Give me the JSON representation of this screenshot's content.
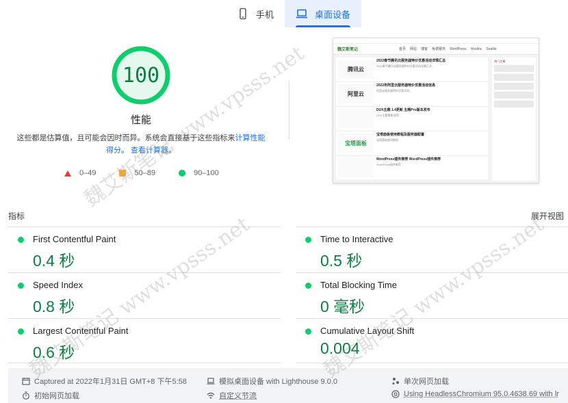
{
  "tabs": [
    {
      "label": "手机",
      "icon": "phone-icon",
      "active": false
    },
    {
      "label": "桌面设备",
      "icon": "laptop-icon",
      "active": true
    }
  ],
  "gauge": {
    "score": "100",
    "title": "性能",
    "color": "#0cce6b"
  },
  "description": {
    "text": "这些都是估算值，且可能会因时而异。系统会直接基于这些指标来",
    "link1": "计算性能得分",
    "mid": "。",
    "link2": "查看计算器",
    "end": "。"
  },
  "legend": [
    {
      "shape": "triangle",
      "color": "#ff3333",
      "label": "0–49"
    },
    {
      "shape": "square",
      "color": "#ffaa33",
      "label": "50–89"
    },
    {
      "shape": "circle",
      "color": "#0cce6b",
      "label": "90–100"
    }
  ],
  "thumbnail": {
    "logo": "魏艾斯笔记",
    "nav": [
      "首页",
      "网站",
      "博客",
      "免费服务",
      "WordPress",
      "Hostloc",
      "Seafile"
    ],
    "posts": [
      {
        "img": "腾讯云",
        "title": "2022春节腾讯云服务器特价优惠活动详情汇总",
        "text": "2022春节腾讯云服务器特价优惠活动详情汇总..."
      },
      {
        "img": "阿里云",
        "title": "2022年阿里云服务器特价优惠活动信息",
        "text": "阿里云服务器特价优惠活动..."
      },
      {
        "img": "",
        "title": "DUX主题 1.4更新 主题Pro版本发布",
        "text": "DUX主题更新说明..."
      },
      {
        "img": "宝塔面板",
        "title": "宝塔面板使用教程及服务器配置",
        "text": "宝塔面板使用教程..."
      },
      {
        "img": "",
        "title": "WordPress插件推荐 WordPress插件推荐",
        "text": "WordPress插件推荐..."
      }
    ],
    "side_title": "热门文章"
  },
  "metrics_header": {
    "left": "指标",
    "right": "展开视图"
  },
  "metrics": [
    {
      "title": "First Contentful Paint",
      "value": "0.4 秒"
    },
    {
      "title": "Time to Interactive",
      "value": "0.5 秒"
    },
    {
      "title": "Speed Index",
      "value": "0.8 秒"
    },
    {
      "title": "Total Blocking Time",
      "value": "0 毫秒"
    },
    {
      "title": "Largest Contentful Paint",
      "value": "0.6 秒"
    },
    {
      "title": "Cumulative Layout Shift",
      "value": "0.004"
    }
  ],
  "footer": {
    "captured": "Captured at 2022年1月31日 GMT+8 下午5:58",
    "device": "模拟桌面设备 with Lighthouse 9.0.0",
    "session": "单次网页加载",
    "initial": "初始网页加载",
    "throttle": "自定义节流",
    "browser": "Using HeadlessChromium 95.0.4638.69 with lr"
  },
  "watermark": "魏艾斯笔记 www.vpsss.net"
}
